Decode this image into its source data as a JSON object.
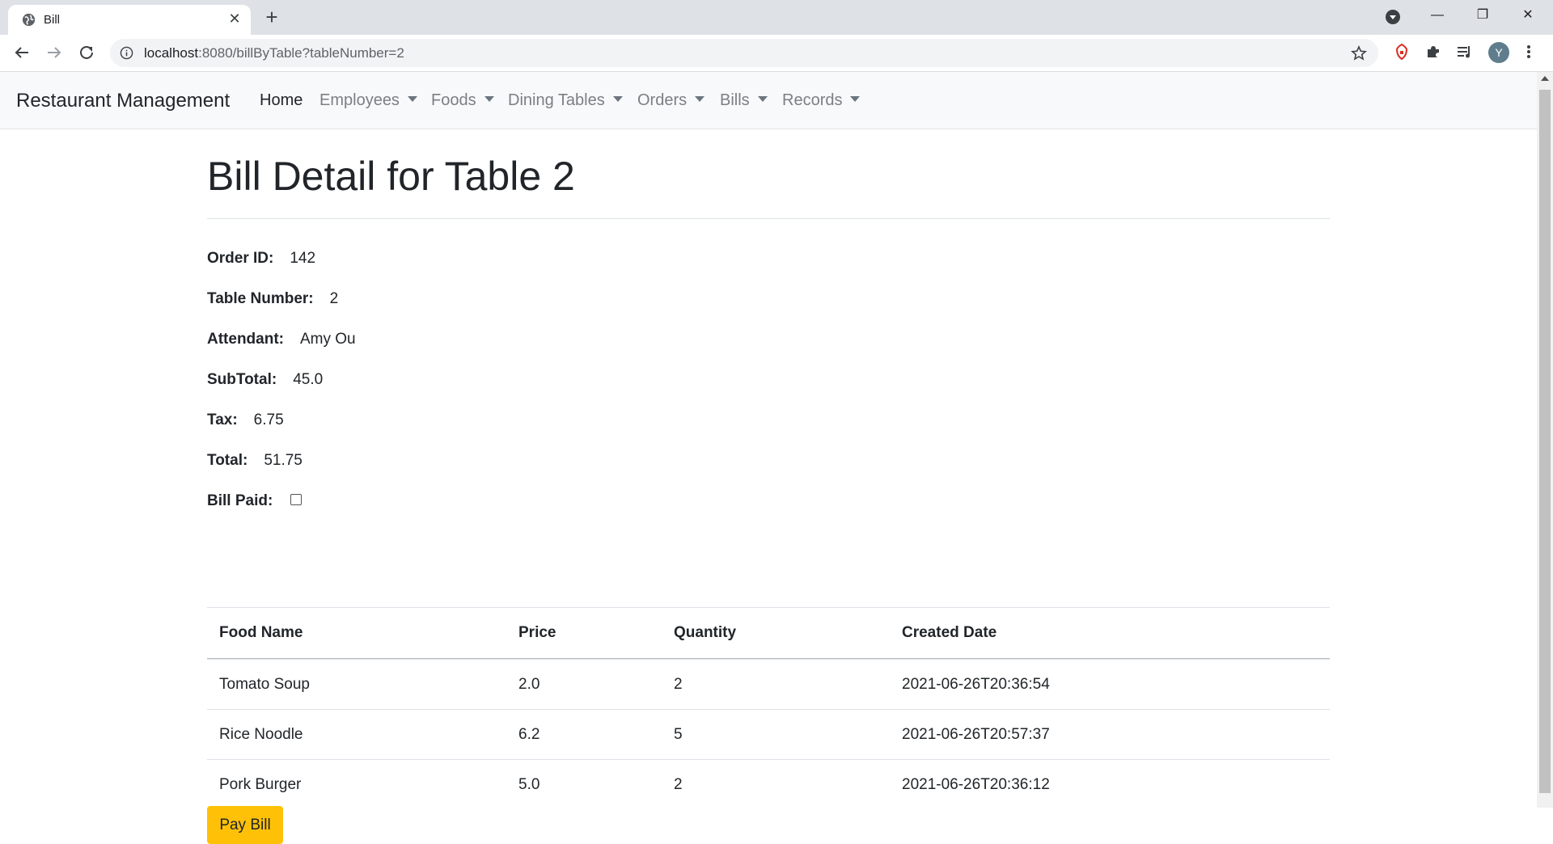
{
  "browser": {
    "tab_title": "Bill",
    "url_host": "localhost",
    "url_rest": ":8080/billByTable?tableNumber=2",
    "avatar_letter": "Y"
  },
  "navbar": {
    "brand": "Restaurant Management",
    "items": [
      {
        "label": "Home",
        "active": true,
        "dropdown": false
      },
      {
        "label": "Employees",
        "active": false,
        "dropdown": true
      },
      {
        "label": "Foods",
        "active": false,
        "dropdown": true
      },
      {
        "label": "Dining Tables",
        "active": false,
        "dropdown": true
      },
      {
        "label": "Orders",
        "active": false,
        "dropdown": true
      },
      {
        "label": "Bills",
        "active": false,
        "dropdown": true
      },
      {
        "label": "Records",
        "active": false,
        "dropdown": true
      }
    ]
  },
  "bill": {
    "title": "Bill Detail for Table 2",
    "fields": [
      {
        "label": "Order ID:",
        "value": "142"
      },
      {
        "label": "Table Number:",
        "value": "2"
      },
      {
        "label": "Attendant:",
        "value": "Amy Ou"
      },
      {
        "label": "SubTotal:",
        "value": "45.0"
      },
      {
        "label": "Tax:",
        "value": "6.75"
      },
      {
        "label": "Total:",
        "value": "51.75"
      }
    ],
    "paid_label": "Bill Paid:",
    "paid": false
  },
  "table": {
    "columns": [
      "Food Name",
      "Price",
      "Quantity",
      "Created Date"
    ],
    "rows": [
      [
        "Tomato Soup",
        "2.0",
        "2",
        "2021-06-26T20:36:54"
      ],
      [
        "Rice Noodle",
        "6.2",
        "5",
        "2021-06-26T20:57:37"
      ],
      [
        "Pork Burger",
        "5.0",
        "2",
        "2021-06-26T20:36:12"
      ]
    ]
  },
  "actions": {
    "pay_label": "Pay Bill"
  },
  "colors": {
    "pay_button": "#ffc107",
    "navbar_bg": "#f8f9fa"
  }
}
